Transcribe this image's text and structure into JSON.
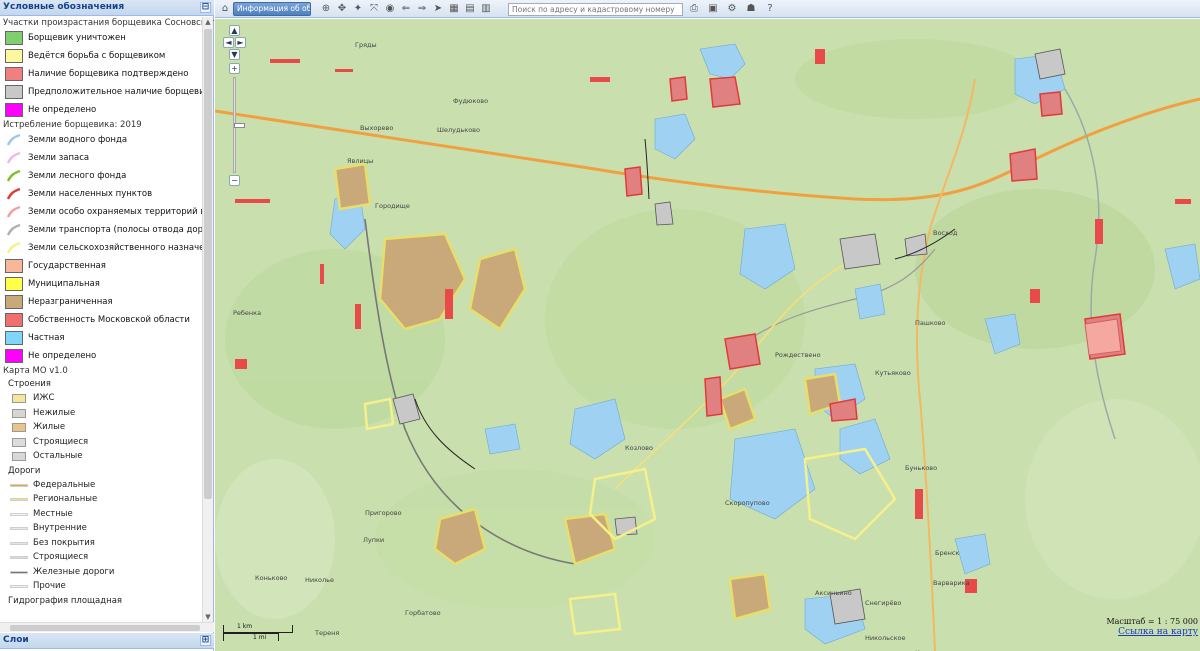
{
  "legend_panel": {
    "title": "Условные обозначения",
    "collapse_glyph": "⊟",
    "group1_title": "Участки произрастания борщевика Сосновского",
    "group1_items": [
      {
        "label": "Борщевик уничтожен",
        "color": "#7fcf6e"
      },
      {
        "label": "Ведётся борьба с борщевиком",
        "color": "#fff7a0"
      },
      {
        "label": "Наличие борщевика подтверждено",
        "color": "#f08080"
      },
      {
        "label": "Предположительное наличие борщевика",
        "color": "#c8c8c8"
      },
      {
        "label": "Не определено",
        "color": "#ff00ff"
      }
    ],
    "group2_title": "Истребление борщевика: 2019",
    "group2_lines": [
      {
        "label": "Земли водного фонда",
        "color": "#9ec6f0"
      },
      {
        "label": "Земли запаса",
        "color": "#f0b8e8"
      },
      {
        "label": "Земли лесного фонда",
        "color": "#7fbf2a"
      },
      {
        "label": "Земли населенных пунктов",
        "color": "#e03a3a"
      },
      {
        "label": "Земли особо охраняемых территорий и объен",
        "color": "#f4a0a0"
      },
      {
        "label": "Земли транспорта (полосы отвода дорог), про",
        "color": "#b0b0b0"
      },
      {
        "label": "Земли сельскохозяйственного назначения",
        "color": "#f6f08a"
      }
    ],
    "group2_fills": [
      {
        "label": "Государственная",
        "color": "#f8b79a"
      },
      {
        "label": "Муниципальная",
        "color": "#ffff4a"
      },
      {
        "label": "Неразграниченная",
        "color": "#c9a87a"
      },
      {
        "label": "Собственность Московской области",
        "color": "#f07070"
      },
      {
        "label": "Частная",
        "color": "#7fd6f8"
      },
      {
        "label": "Не определено",
        "color": "#ff00ff"
      }
    ],
    "group3_title": "Карта МО v1.0",
    "buildings_title": "Строения",
    "buildings": [
      {
        "label": "ИЖС",
        "color": "#f5e79a"
      },
      {
        "label": "Нежилые",
        "color": "#d6d6d6"
      },
      {
        "label": "Жилые",
        "color": "#e8c48a"
      },
      {
        "label": "Строящиеся",
        "color": "#dcdcdc"
      },
      {
        "label": "Остальные",
        "color": "#d8d8d8"
      }
    ],
    "roads_title": "Дороги",
    "roads": [
      {
        "label": "Федеральные",
        "color": "#f0a040"
      },
      {
        "label": "Региональные",
        "color": "#f6df7a"
      },
      {
        "label": "Местные",
        "color": "#f4f4f4"
      },
      {
        "label": "Внутренние",
        "color": "#e8e8e8"
      },
      {
        "label": "Без покрытия",
        "color": "#e4e4d8"
      },
      {
        "label": "Строящиеся",
        "color": "#dadada"
      },
      {
        "label": "Железные дороги",
        "color": "#777777"
      },
      {
        "label": "Прочие",
        "color": "#eeeeee"
      }
    ],
    "hydro_title": "Гидрография площадная"
  },
  "layers_panel": {
    "title": "Слои",
    "expand_glyph": "⊞"
  },
  "toolbar": {
    "home_icon": "⌂",
    "info_button_label": "Информация об объекте",
    "search_placeholder": "Поиск по адресу и кадастровому номеру",
    "tool_glyphs": [
      "⊕",
      "✥",
      "✦",
      "⤧",
      "◉",
      "⇐",
      "⇒",
      "➤",
      "▦",
      "▤",
      "▥"
    ],
    "right_glyphs": [
      "⎙",
      "▣",
      "⚙",
      "☗",
      "?"
    ]
  },
  "map": {
    "place_names": [
      "Гряды",
      "Фудюково",
      "Выхорево",
      "Шелудьково",
      "Явлицы",
      "Городище",
      "Никольское",
      "Рождествено",
      "Пашково",
      "Козлово",
      "Скоропупово",
      "Кутьяково",
      "Буньково",
      "Варварика",
      "Бренск",
      "Аксиньино",
      "Снегирёво",
      "Кузьмино",
      "Лупки",
      "Николье",
      "Пригорово",
      "Восход",
      "Ребенка",
      "Коньково",
      "Горбатово",
      "Тереня"
    ],
    "zoom_labels": {
      "plus": "+",
      "minus": "−",
      "up": "▲",
      "down": "▼",
      "left": "◄",
      "right": "►"
    },
    "scale_km": "1 km",
    "scale_mi": "1 mi",
    "scale_text": "Масштаб = 1 : 75 000",
    "link_text": "Ссылка на карту"
  }
}
